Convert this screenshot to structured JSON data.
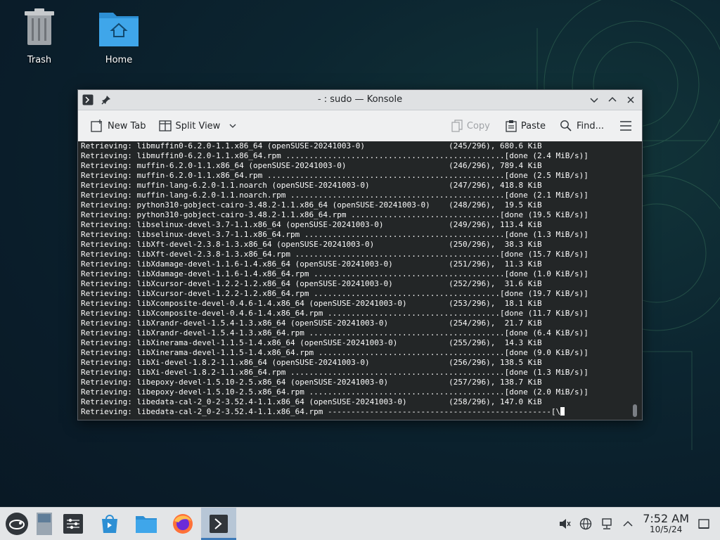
{
  "desktop": {
    "icons": [
      {
        "label": "Trash",
        "icon": "trash-icon"
      },
      {
        "label": "Home",
        "icon": "home-folder-icon"
      }
    ]
  },
  "window": {
    "title": "- : sudo — Konsole",
    "toolbar": {
      "new_tab": "New Tab",
      "split_view": "Split View",
      "copy": "Copy",
      "paste": "Paste",
      "find": "Find..."
    }
  },
  "terminal": {
    "lines": [
      "Retrieving: libmuffin0-6.2.0-1.1.x86_64 (openSUSE-20241003-0)                  (245/296), 680.6 KiB",
      "Retrieving: libmuffin0-6.2.0-1.1.x86_64.rpm ...............................................[done (2.4 MiB/s)]",
      "Retrieving: muffin-6.2.0-1.1.x86_64 (openSUSE-20241003-0)                      (246/296), 789.4 KiB",
      "Retrieving: muffin-6.2.0-1.1.x86_64.rpm ...................................................[done (2.5 MiB/s)]",
      "Retrieving: muffin-lang-6.2.0-1.1.noarch (openSUSE-20241003-0)                 (247/296), 418.8 KiB",
      "Retrieving: muffin-lang-6.2.0-1.1.noarch.rpm ..............................................[done (2.1 MiB/s)]",
      "Retrieving: python310-gobject-cairo-3.48.2-1.1.x86_64 (openSUSE-20241003-0)    (248/296),  19.5 KiB",
      "Retrieving: python310-gobject-cairo-3.48.2-1.1.x86_64.rpm ................................[done (19.5 KiB/s)]",
      "Retrieving: libselinux-devel-3.7-1.1.x86_64 (openSUSE-20241003-0)              (249/296), 113.4 KiB",
      "Retrieving: libselinux-devel-3.7-1.1.x86_64.rpm ...........................................[done (1.3 MiB/s)]",
      "Retrieving: libXft-devel-2.3.8-1.3.x86_64 (openSUSE-20241003-0)                (250/296),  38.3 KiB",
      "Retrieving: libXft-devel-2.3.8-1.3.x86_64.rpm ............................................[done (15.7 KiB/s)]",
      "Retrieving: libXdamage-devel-1.1.6-1.4.x86_64 (openSUSE-20241003-0)            (251/296),  11.3 KiB",
      "Retrieving: libXdamage-devel-1.1.6-1.4.x86_64.rpm .........................................[done (1.0 KiB/s)]",
      "Retrieving: libXcursor-devel-1.2.2-1.2.x86_64 (openSUSE-20241003-0)            (252/296),  31.6 KiB",
      "Retrieving: libXcursor-devel-1.2.2-1.2.x86_64.rpm ........................................[done (19.7 KiB/s)]",
      "Retrieving: libXcomposite-devel-0.4.6-1.4.x86_64 (openSUSE-20241003-0)         (253/296),  18.1 KiB",
      "Retrieving: libXcomposite-devel-0.4.6-1.4.x86_64.rpm .....................................[done (11.7 KiB/s)]",
      "Retrieving: libXrandr-devel-1.5.4-1.3.x86_64 (openSUSE-20241003-0)             (254/296),  21.7 KiB",
      "Retrieving: libXrandr-devel-1.5.4-1.3.x86_64.rpm ..........................................[done (6.4 KiB/s)]",
      "Retrieving: libXinerama-devel-1.1.5-1.4.x86_64 (openSUSE-20241003-0)           (255/296),  14.3 KiB",
      "Retrieving: libXinerama-devel-1.1.5-1.4.x86_64.rpm ........................................[done (9.0 KiB/s)]",
      "Retrieving: libXi-devel-1.8.2-1.1.x86_64 (openSUSE-20241003-0)                 (256/296), 138.5 KiB",
      "Retrieving: libXi-devel-1.8.2-1.1.x86_64.rpm ..............................................[done (1.3 MiB/s)]",
      "Retrieving: libepoxy-devel-1.5.10-2.5.x86_64 (openSUSE-20241003-0)             (257/296), 138.7 KiB",
      "Retrieving: libepoxy-devel-1.5.10-2.5.x86_64.rpm ..........................................[done (2.0 MiB/s)]",
      "Retrieving: libedata-cal-2_0-2-3.52.4-1.1.x86_64 (openSUSE-20241003-0)         (258/296), 147.0 KiB",
      "Retrieving: libedata-cal-2_0-2-3.52.4-1.1.x86_64.rpm ------------------------------------------------[\\"
    ]
  },
  "taskbar": {
    "apps": [
      {
        "name": "application-launcher-icon"
      },
      {
        "name": "pager-icon"
      },
      {
        "name": "system-settings-icon"
      },
      {
        "name": "discover-icon"
      },
      {
        "name": "dolphin-icon"
      },
      {
        "name": "firefox-icon"
      },
      {
        "name": "konsole-icon"
      }
    ],
    "clock": {
      "time": "7:52 AM",
      "date": "10/5/24"
    }
  }
}
